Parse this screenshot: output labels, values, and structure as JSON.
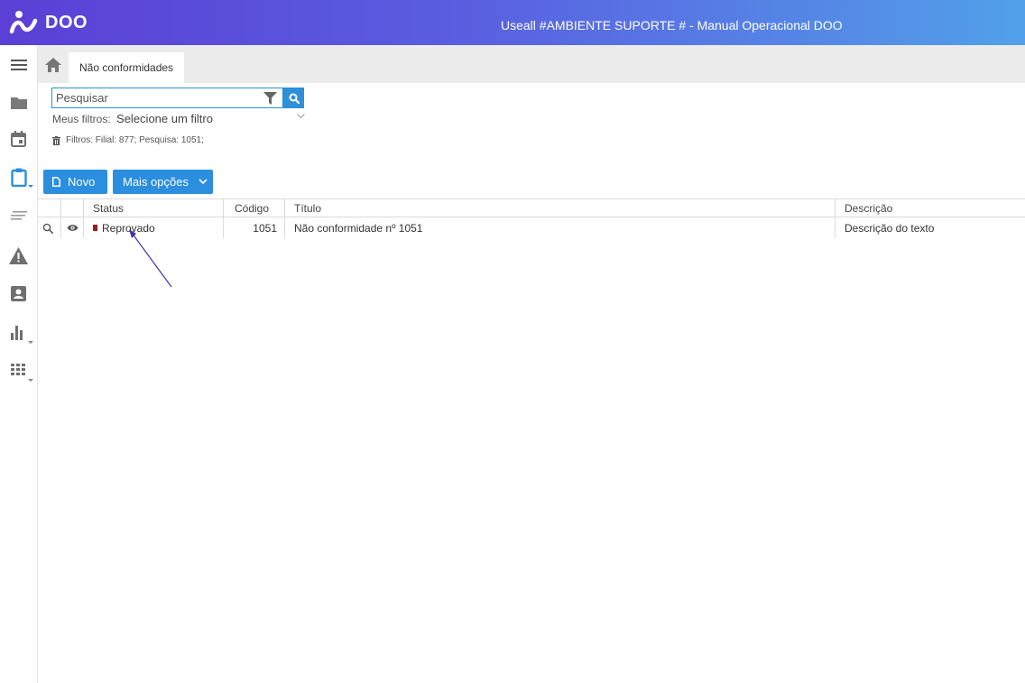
{
  "app": {
    "logo_text": "DOO",
    "window_title": "Useall #AMBIENTE SUPORTE # - Manual Operacional DOO"
  },
  "tabs": [
    {
      "label": "Não conformidades"
    }
  ],
  "search": {
    "placeholder": "Pesquisar",
    "meus_filtros_label": "Meus filtros:",
    "meus_filtros_value": "Selecione um filtro",
    "active_filters": "Filtros: Filial: 877; Pesquisa: 1051;"
  },
  "toolbar": {
    "novo_label": "Novo",
    "mais_opcoes_label": "Mais opções"
  },
  "table": {
    "columns": [
      "Status",
      "Código",
      "Título",
      "Descrição"
    ],
    "rows": [
      {
        "status": "Reprovado",
        "codigo": "1051",
        "titulo": "Não conformidade nº 1051",
        "descricao": "Descrição do texto"
      }
    ]
  },
  "sidebar": {
    "items": [
      {
        "icon": "menu-icon"
      },
      {
        "icon": "folder-icon"
      },
      {
        "icon": "calendar-icon"
      },
      {
        "icon": "clipboard-icon"
      },
      {
        "icon": "lines-icon"
      },
      {
        "icon": "warning-icon"
      },
      {
        "icon": "contact-icon"
      },
      {
        "icon": "bar-chart-icon"
      },
      {
        "icon": "grid-icon"
      }
    ]
  },
  "colors": {
    "header_gradient_start": "#5b3fd6",
    "header_gradient_end": "#52a0ea",
    "accent": "#2b8ede",
    "status_reprovado": "#9b1c1c",
    "active_sidebar_icon": "#2b8ede"
  }
}
